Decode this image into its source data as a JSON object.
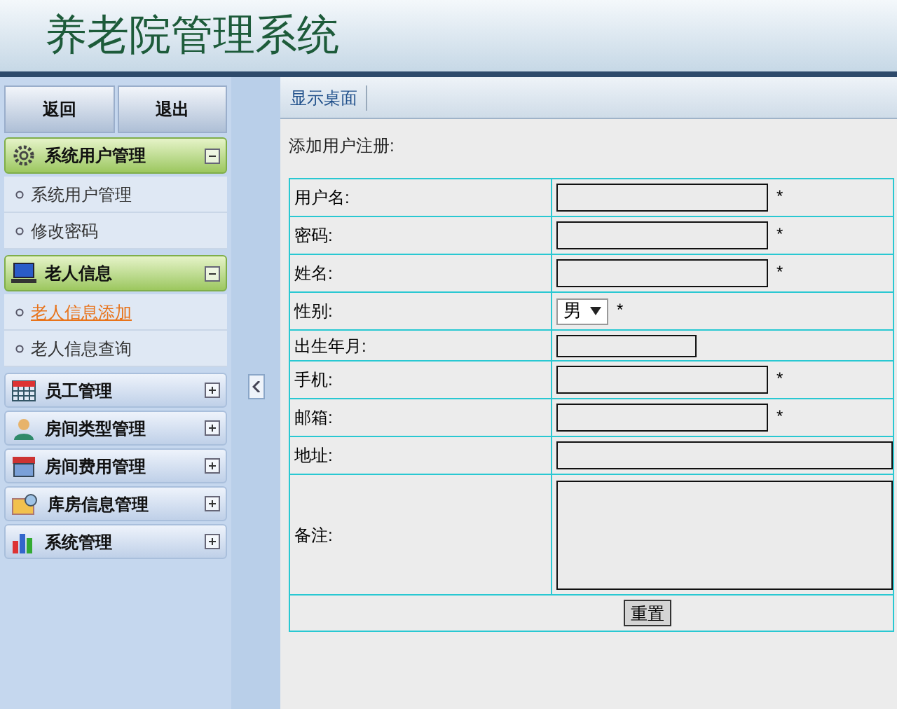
{
  "header": {
    "title": "养老院管理系统"
  },
  "sidebar": {
    "buttons": [
      "返回",
      "退出"
    ],
    "groups": [
      {
        "title": "系统用户管理",
        "expanded": true,
        "items": [
          {
            "label": "系统用户管理",
            "selected": false
          },
          {
            "label": "修改密码",
            "selected": false
          }
        ]
      },
      {
        "title": "老人信息",
        "expanded": true,
        "items": [
          {
            "label": "老人信息添加",
            "selected": true
          },
          {
            "label": "老人信息查询",
            "selected": false
          }
        ]
      },
      {
        "title": "员工管理",
        "expanded": false
      },
      {
        "title": "房间类型管理",
        "expanded": false
      },
      {
        "title": "房间费用管理",
        "expanded": false
      },
      {
        "title": "库房信息管理",
        "expanded": false
      },
      {
        "title": "系统管理",
        "expanded": false
      }
    ]
  },
  "tabs": [
    {
      "label": "显示桌面",
      "selected": true
    }
  ],
  "form": {
    "title": "添加用户注册:",
    "fields": [
      {
        "label": "用户名:",
        "kind": "text",
        "mark": "*"
      },
      {
        "label": "密码:",
        "kind": "text",
        "mark": "*"
      },
      {
        "label": "姓名:",
        "kind": "text",
        "mark": "*"
      },
      {
        "label": "性别:",
        "kind": "select",
        "value": "男",
        "mark": "*"
      },
      {
        "label": "出生年月:",
        "kind": "short"
      },
      {
        "label": "手机:",
        "kind": "text",
        "mark": "*"
      },
      {
        "label": "邮箱:",
        "kind": "text",
        "mark": "*"
      },
      {
        "label": "地址:",
        "kind": "wide"
      },
      {
        "label": "备注:",
        "kind": "textarea"
      }
    ],
    "buttons": [
      "重置"
    ]
  }
}
